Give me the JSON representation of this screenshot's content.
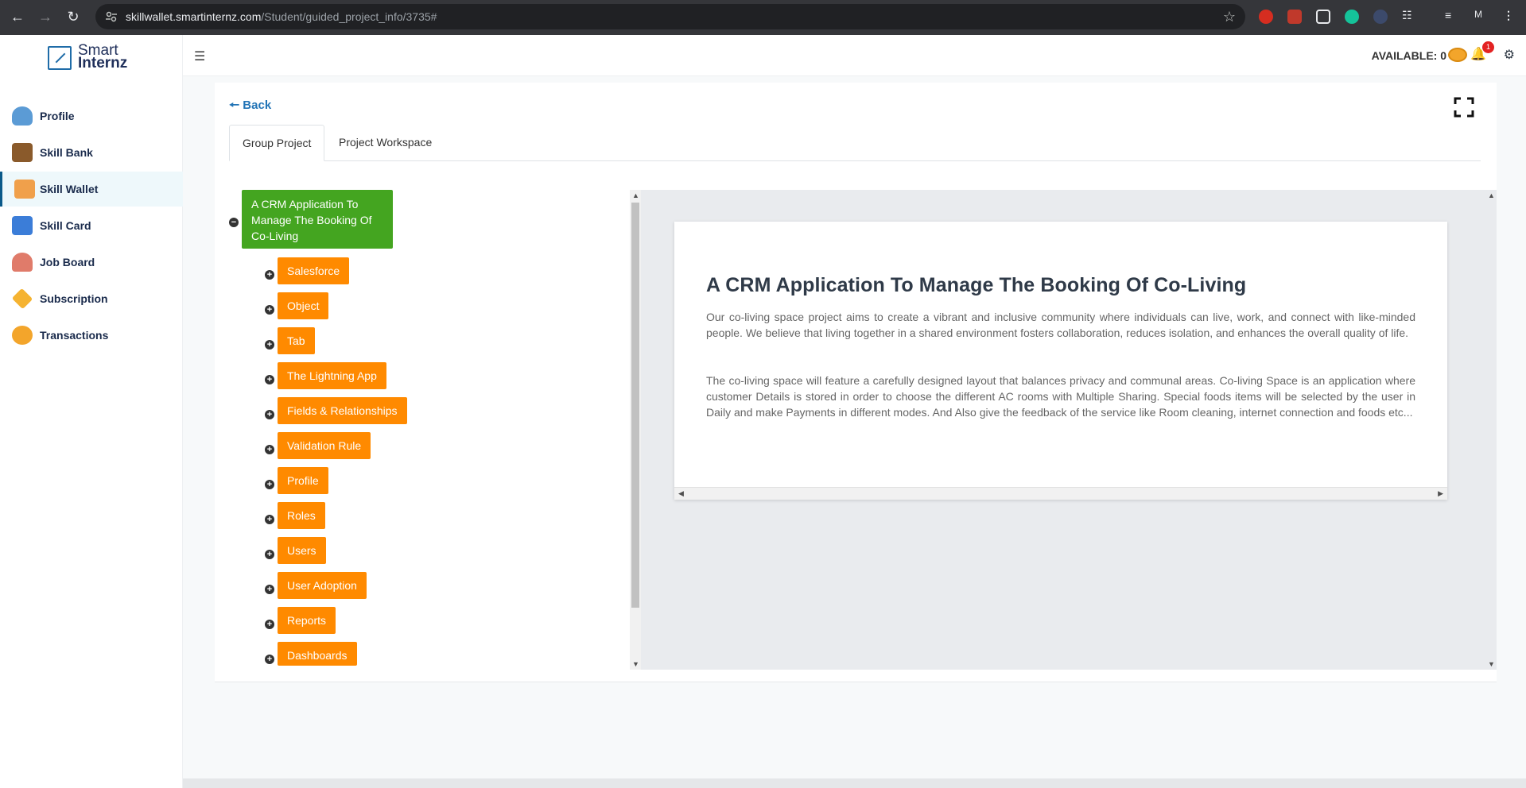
{
  "browser": {
    "url_host": "skillwallet.smartinternz.com",
    "url_path": "/Student/guided_project_info/3735#",
    "profile_initial": "M"
  },
  "sidebar": {
    "logo_line1": "Smart",
    "logo_line2": "Internz",
    "items": [
      {
        "label": "Profile",
        "icon": "profile-icon",
        "color": "#5b9bd5"
      },
      {
        "label": "Skill Bank",
        "icon": "briefcase-icon",
        "color": "#8a5a2b"
      },
      {
        "label": "Skill Wallet",
        "icon": "wallet-icon",
        "color": "#f0a04b"
      },
      {
        "label": "Skill Card",
        "icon": "id-card-icon",
        "color": "#3b7dd8"
      },
      {
        "label": "Job Board",
        "icon": "job-person-icon",
        "color": "#e07b6a"
      },
      {
        "label": "Subscription",
        "icon": "diamond-icon",
        "color": "#f5b331"
      },
      {
        "label": "Transactions",
        "icon": "coins-icon",
        "color": "#f3a52b"
      }
    ],
    "active_index": 2
  },
  "header": {
    "available_label": "AVAILABLE: 0",
    "notification_count": "1"
  },
  "main": {
    "back_label": "Back",
    "tabs": [
      "Group Project",
      "Project Workspace"
    ],
    "active_tab": 0
  },
  "tree": {
    "root_label": "A CRM Application To Manage The Booking Of Co-Living",
    "nodes": [
      "Salesforce",
      "Object",
      "Tab",
      "The Lightning App",
      "Fields & Relationships",
      "Validation Rule",
      "Profile",
      "Roles",
      "Users",
      "User Adoption",
      "Reports",
      "Dashboards"
    ]
  },
  "document": {
    "title": "A CRM Application To Manage The Booking Of Co-Living",
    "paragraph1": "Our co-living space project aims to create a vibrant and inclusive community where individuals can live, work, and connect with like-minded people. We believe that living together in a shared environment fosters collaboration, reduces isolation, and enhances the overall quality of life.",
    "paragraph2": "The co-living space will feature a carefully designed layout that balances privacy and communal areas. Co-living Space is an application where customer Details is stored in order to choose the different AC rooms with Multiple Sharing. Special foods items will be selected by the user in Daily and make Payments in different modes. And Also give the feedback of the service like Room cleaning, internet connection and foods etc..."
  },
  "colors": {
    "root_node": "#44a520",
    "child_node": "#ff8a00",
    "link": "#2274b6"
  }
}
